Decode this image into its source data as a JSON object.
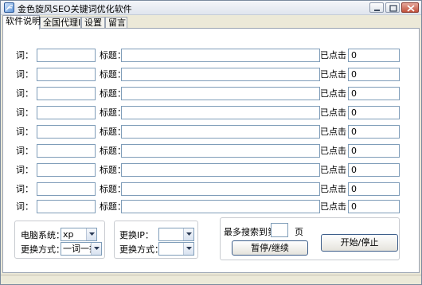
{
  "window": {
    "title": "金色旋风SEO关键词优化软件"
  },
  "tabs": [
    {
      "label": "软件说明"
    },
    {
      "label": "全国代理IP"
    },
    {
      "label": "设置"
    },
    {
      "label": "留言"
    }
  ],
  "rows": [
    {
      "word_label": "词：",
      "word": "",
      "title_label": "标题：",
      "title": "",
      "clicks_label": "已点击",
      "clicks": "0"
    },
    {
      "word_label": "词：",
      "word": "",
      "title_label": "标题：",
      "title": "",
      "clicks_label": "已点击",
      "clicks": "0"
    },
    {
      "word_label": "词：",
      "word": "",
      "title_label": "标题：",
      "title": "",
      "clicks_label": "已点击",
      "clicks": "0"
    },
    {
      "word_label": "词：",
      "word": "",
      "title_label": "标题：",
      "title": "",
      "clicks_label": "已点击",
      "clicks": "0"
    },
    {
      "word_label": "词：",
      "word": "",
      "title_label": "标题：",
      "title": "",
      "clicks_label": "已点击",
      "clicks": "0"
    },
    {
      "word_label": "词：",
      "word": "",
      "title_label": "标题：",
      "title": "",
      "clicks_label": "已点击",
      "clicks": "0"
    },
    {
      "word_label": "词：",
      "word": "",
      "title_label": "标题：",
      "title": "",
      "clicks_label": "已点击",
      "clicks": "0"
    },
    {
      "word_label": "词：",
      "word": "",
      "title_label": "标题：",
      "title": "",
      "clicks_label": "已点击",
      "clicks": "0"
    },
    {
      "word_label": "词：",
      "word": "",
      "title_label": "标题：",
      "title": "",
      "clicks_label": "已点击",
      "clicks": "0"
    }
  ],
  "settings": {
    "os_label": "电脑系统：",
    "os_value": "xp",
    "change_mode_label": "更换方式：",
    "change_mode_value": "一词一换",
    "change_ip_label": "更换IP：",
    "change_ip_value": "",
    "change_mode2_label": "更换方式：",
    "change_mode2_value": "",
    "max_search_label": "最多搜索到第",
    "max_search_value": "",
    "page_unit": "页",
    "pause_button": "暂停/继续",
    "start_button": "开始/停止"
  }
}
